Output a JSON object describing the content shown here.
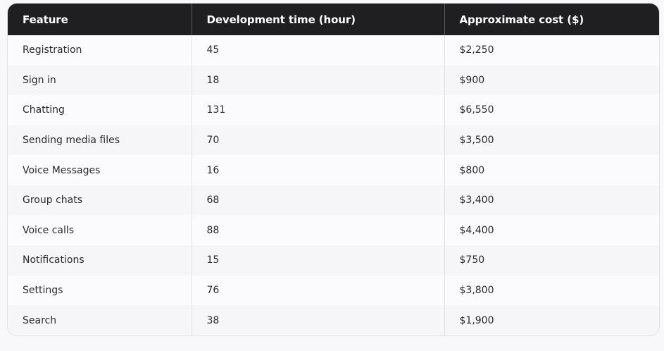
{
  "table": {
    "headers": [
      "Feature",
      "Development time (hour)",
      "Approximate cost ($)"
    ],
    "rows": [
      [
        "Registration",
        "45",
        "$2,250"
      ],
      [
        "Sign in",
        "18",
        "$900"
      ],
      [
        "Chatting",
        "131",
        "$6,550"
      ],
      [
        "Sending media files",
        "70",
        "$3,500"
      ],
      [
        "Voice Messages",
        "16",
        "$800"
      ],
      [
        "Group chats",
        "68",
        "$3,400"
      ],
      [
        "Voice calls",
        "88",
        "$4,400"
      ],
      [
        "Notifications",
        "15",
        "$750"
      ],
      [
        "Settings",
        "76",
        "$3,800"
      ],
      [
        "Search",
        "38",
        "$1,900"
      ]
    ]
  }
}
